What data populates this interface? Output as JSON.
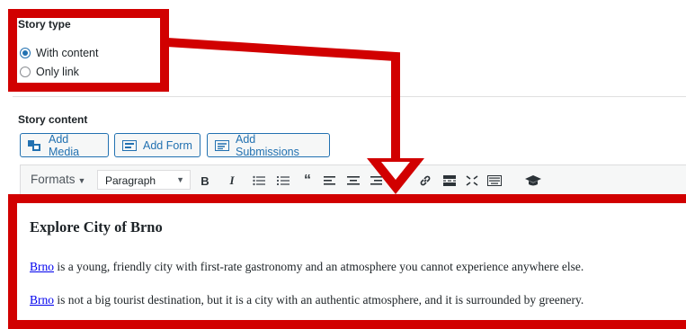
{
  "story_type": {
    "title": "Story type",
    "options": [
      {
        "label": "With content",
        "selected": true
      },
      {
        "label": "Only link",
        "selected": false
      }
    ]
  },
  "story_content": {
    "title": "Story content",
    "media_buttons": [
      {
        "label": "Add Media",
        "icon": "add-media-icon"
      },
      {
        "label": "Add Form",
        "icon": "form-icon"
      },
      {
        "label": "Add Submissions",
        "icon": "submissions-icon"
      }
    ],
    "toolbar": {
      "formats_label": "Formats",
      "block_format": "Paragraph",
      "icons": [
        "bold-icon",
        "italic-icon",
        "bullet-list-icon",
        "numbered-list-icon",
        "blockquote-icon",
        "align-left-icon",
        "align-center-icon",
        "align-right-icon",
        "link-icon",
        "read-more-icon",
        "fullscreen-icon",
        "keyboard-icon",
        "graduation-cap-icon"
      ]
    },
    "editor": {
      "heading": "Explore City of Brno",
      "paragraph_1_link": "Brno",
      "paragraph_1_text": " is a young, friendly city with first-rate gastronomy and an atmosphere you cannot experience anywhere else.",
      "paragraph_2_link": "Brno",
      "paragraph_2_text": " is not a big tourist destination, but it is a city with an authentic atmosphere, and it is surrounded by greenery."
    }
  },
  "colors": {
    "annotation_red": "#d10000",
    "accent_blue": "#2271b1",
    "link_blue": "#0000ee"
  }
}
